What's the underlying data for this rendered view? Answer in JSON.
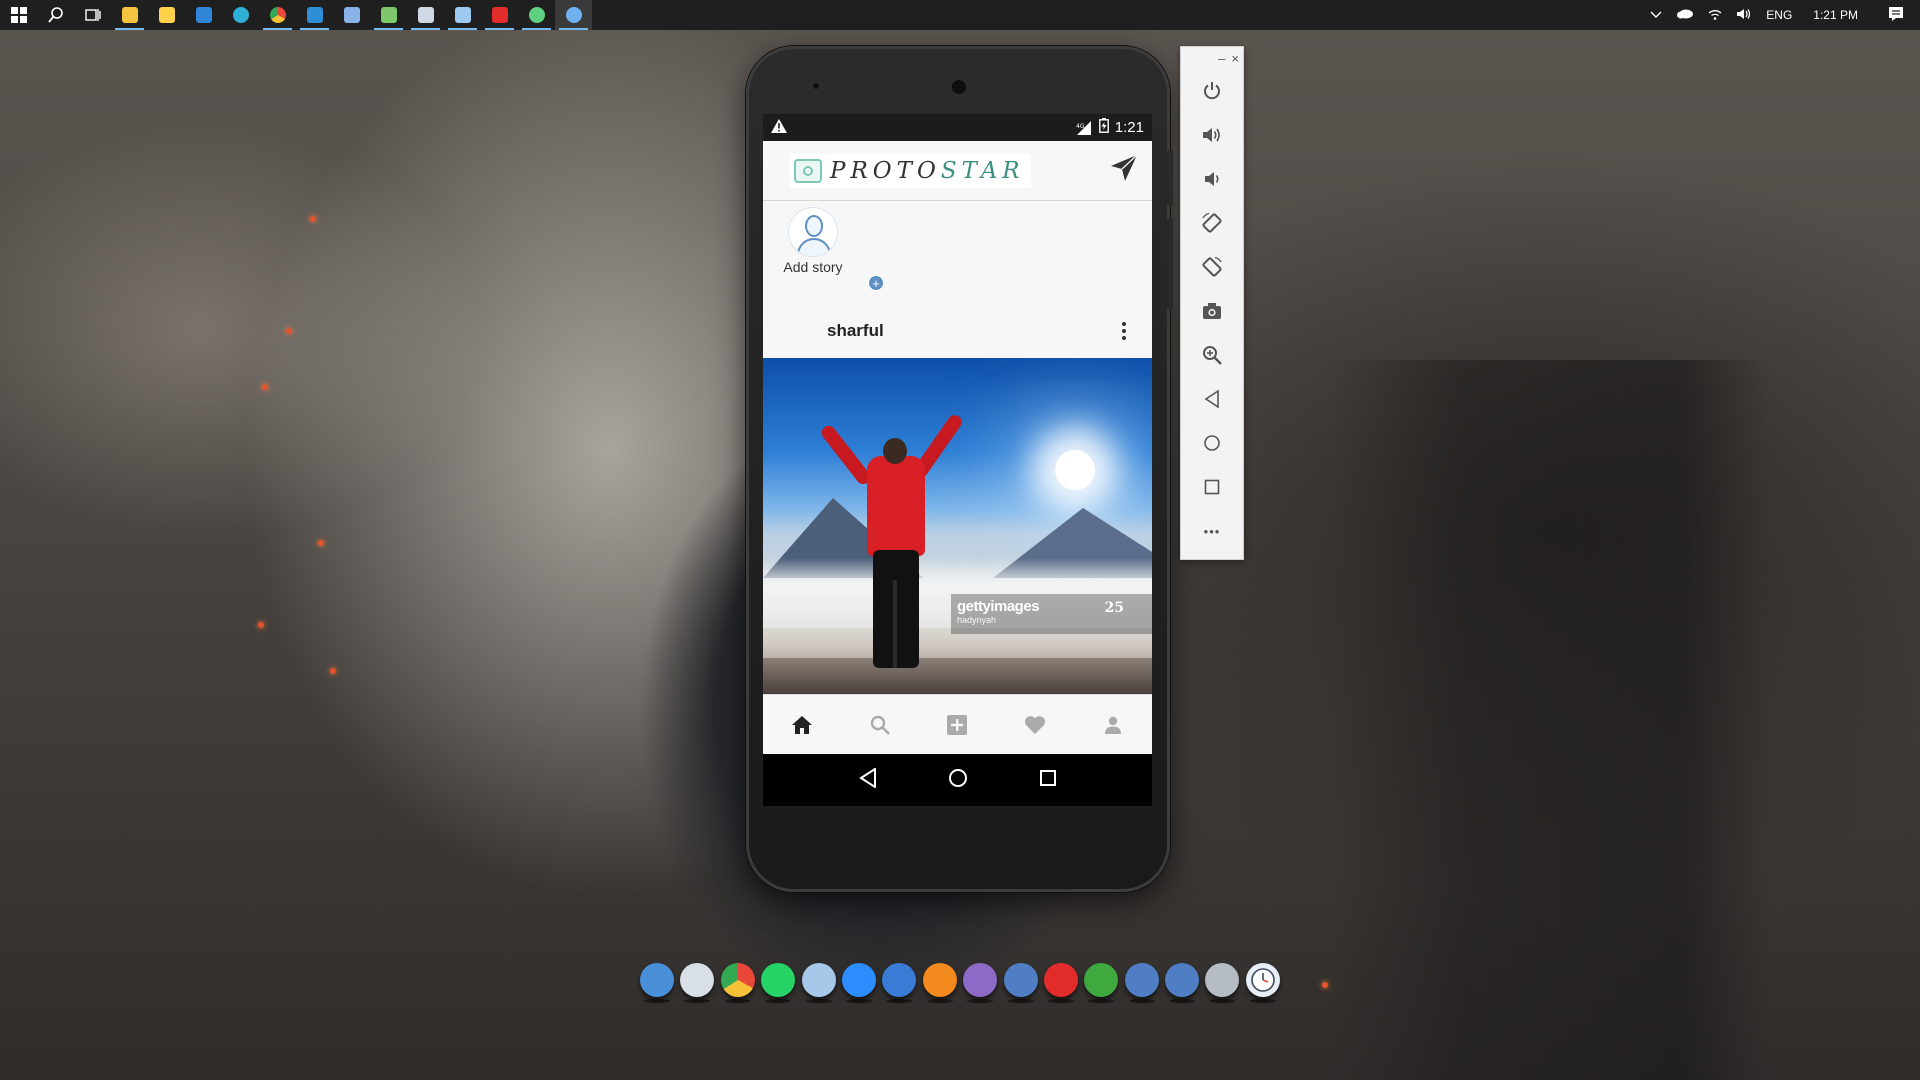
{
  "taskbar": {
    "icons": [
      {
        "name": "windows-start-icon",
        "color": "#ffffff"
      },
      {
        "name": "search-icon",
        "color": "#ffffff"
      },
      {
        "name": "task-view-icon",
        "color": "#ffffff"
      },
      {
        "name": "file-explorer-icon",
        "color": "#f5c542"
      },
      {
        "name": "store-icon",
        "color": "#ffd24a"
      },
      {
        "name": "mail-icon",
        "color": "#2f86d8"
      },
      {
        "name": "edge-icon",
        "color": "#2fb0d6"
      },
      {
        "name": "chrome-icon",
        "color": "#e9473a"
      },
      {
        "name": "vscode-icon",
        "color": "#2e8ed6"
      },
      {
        "name": "virtualbox-icon",
        "color": "#8ab4e8"
      },
      {
        "name": "notepad-icon",
        "color": "#7ec86b"
      },
      {
        "name": "photos-icon",
        "color": "#cfd8e4"
      },
      {
        "name": "powershell-lightning-icon",
        "color": "#9ec9f0"
      },
      {
        "name": "acrobat-icon",
        "color": "#e22c2c"
      },
      {
        "name": "android-studio-icon",
        "color": "#5fd07f"
      },
      {
        "name": "emulator-icon",
        "color": "#6fb1ee"
      }
    ],
    "tray": {
      "language": "ENG",
      "time": "1:21 PM"
    }
  },
  "phone": {
    "status_bar": {
      "signal_label": "4G",
      "time": "1:21"
    },
    "app": {
      "logo_prefix": "PROTO",
      "logo_suffix": "STAR",
      "stories": [
        {
          "label": "Add story"
        }
      ],
      "post": {
        "username": "sharful",
        "watermark_brand": "gettyimages",
        "watermark_credit": "hadynyah",
        "watermark_badge": "25"
      },
      "bottom_nav": [
        "home-icon",
        "search-icon",
        "add-post-icon",
        "heart-icon",
        "profile-icon"
      ]
    },
    "system_nav": [
      "back",
      "home",
      "recents"
    ]
  },
  "emulator_toolbar": {
    "window_controls": [
      "–",
      "×"
    ],
    "buttons": [
      "power-icon",
      "volume-up-icon",
      "volume-down-icon",
      "rotate-left-icon",
      "rotate-right-icon",
      "screenshot-icon",
      "zoom-icon",
      "back-icon",
      "home-icon",
      "overview-icon",
      "more-icon"
    ],
    "more_label": "•••"
  },
  "dock": {
    "items": [
      {
        "name": "dock-finder-icon",
        "color": "#4a90d9"
      },
      {
        "name": "dock-recycle-bin-icon",
        "color": "#d9dfe6"
      },
      {
        "name": "dock-chrome-icon",
        "color": "#e9473a"
      },
      {
        "name": "dock-whatsapp-icon",
        "color": "#25d366"
      },
      {
        "name": "dock-box-icon",
        "color": "#a8c8ea"
      },
      {
        "name": "dock-zoom-icon",
        "color": "#2d8cff"
      },
      {
        "name": "dock-windows-icon",
        "color": "#3a7bd5"
      },
      {
        "name": "dock-vlc-icon",
        "color": "#f28a1e"
      },
      {
        "name": "dock-github-icon",
        "color": "#8e6ac8"
      },
      {
        "name": "dock-network-icon",
        "color": "#4f7ec4"
      },
      {
        "name": "dock-acrobat-icon",
        "color": "#e22c2c"
      },
      {
        "name": "dock-xbox-icon",
        "color": "#3fa83f"
      },
      {
        "name": "dock-network2-icon",
        "color": "#4f7ec4"
      },
      {
        "name": "dock-network3-icon",
        "color": "#4f7ec4"
      },
      {
        "name": "dock-drive-icon",
        "color": "#b6bcc4"
      },
      {
        "name": "dock-clock-icon",
        "color": "#e8eef5"
      }
    ]
  }
}
